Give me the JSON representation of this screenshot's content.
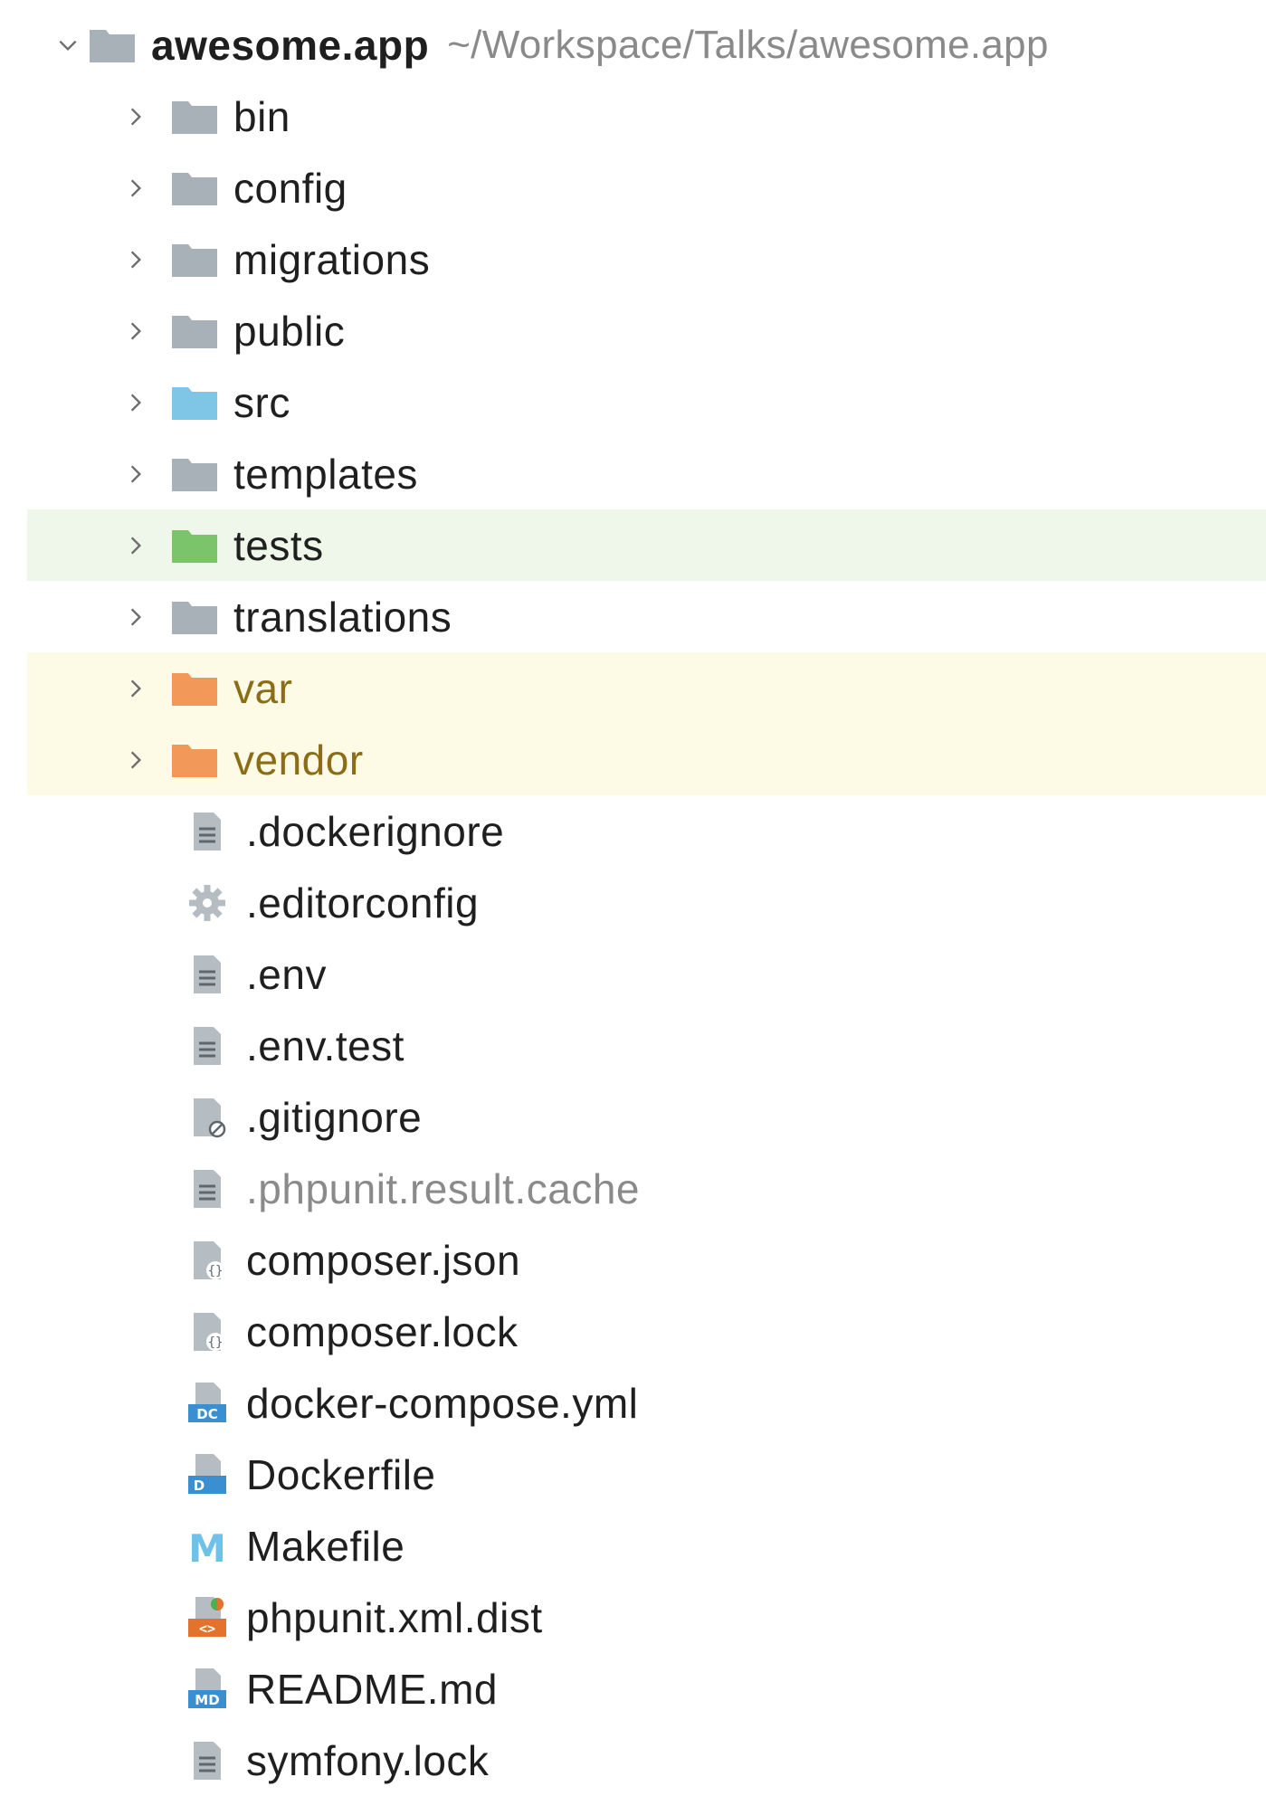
{
  "root": {
    "name": "awesome.app",
    "path": "~/Workspace/Talks/awesome.app"
  },
  "folders": [
    {
      "name": "bin",
      "icon": "folder-icon"
    },
    {
      "name": "config",
      "icon": "folder-icon"
    },
    {
      "name": "migrations",
      "icon": "folder-icon"
    },
    {
      "name": "public",
      "icon": "folder-icon"
    },
    {
      "name": "src",
      "icon": "source-folder-icon"
    },
    {
      "name": "templates",
      "icon": "folder-icon"
    },
    {
      "name": "tests",
      "icon": "test-folder-icon"
    },
    {
      "name": "translations",
      "icon": "folder-icon"
    },
    {
      "name": "var",
      "icon": "excluded-folder-icon"
    },
    {
      "name": "vendor",
      "icon": "excluded-folder-icon"
    }
  ],
  "files": [
    {
      "name": ".dockerignore",
      "icon": "text-file-icon"
    },
    {
      "name": ".editorconfig",
      "icon": "config-gear-icon"
    },
    {
      "name": ".env",
      "icon": "text-file-icon"
    },
    {
      "name": ".env.test",
      "icon": "text-file-icon"
    },
    {
      "name": ".gitignore",
      "icon": "ignore-file-icon"
    },
    {
      "name": ".phpunit.result.cache",
      "icon": "text-file-icon"
    },
    {
      "name": "composer.json",
      "icon": "json-file-icon"
    },
    {
      "name": "composer.lock",
      "icon": "json-file-icon"
    },
    {
      "name": "docker-compose.yml",
      "icon": "docker-compose-file-icon",
      "badge": "DC"
    },
    {
      "name": "Dockerfile",
      "icon": "dockerfile-icon",
      "badge": "D"
    },
    {
      "name": "Makefile",
      "icon": "makefile-icon",
      "badge": "M"
    },
    {
      "name": "phpunit.xml.dist",
      "icon": "xml-file-icon",
      "badge": "<>"
    },
    {
      "name": "README.md",
      "icon": "markdown-file-icon",
      "badge": "MD"
    },
    {
      "name": "symfony.lock",
      "icon": "text-file-icon"
    }
  ],
  "colors": {
    "folder_gray": "#a9b1b8",
    "folder_blue": "#7fc5e6",
    "folder_green": "#7cc46a",
    "folder_orange": "#f2995a",
    "highlight_green": "#eef7ea",
    "highlight_yellow": "#fdfbe6",
    "excluded_text": "#8c6d16",
    "muted_text": "#8a8a8a",
    "badge_blue": "#3a8fd1",
    "badge_orange": "#e2722c"
  }
}
